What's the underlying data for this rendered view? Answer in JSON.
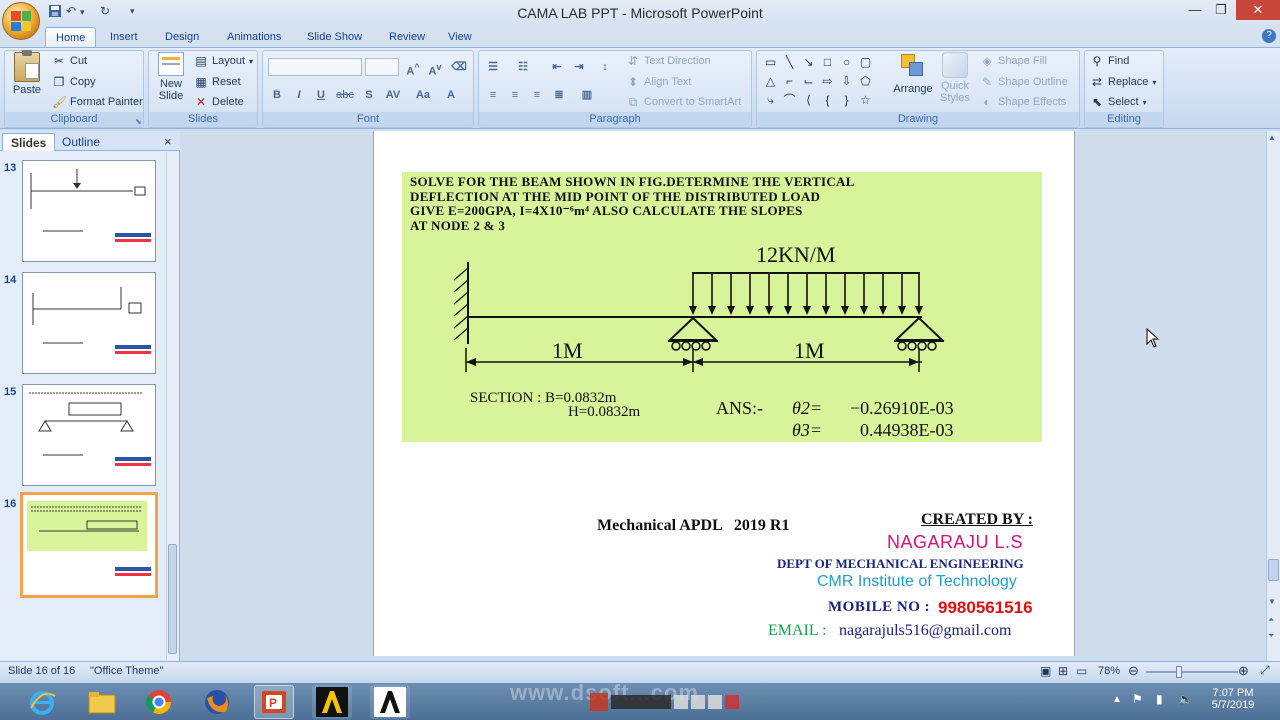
{
  "window": {
    "title": "CAMA LAB PPT - Microsoft PowerPoint",
    "minimize_glyph": "—",
    "restore_glyph": "❐",
    "close_glyph": "✕",
    "qat_icons": [
      "save-icon",
      "undo-icon",
      "redo-icon",
      "customize-qat-icon"
    ]
  },
  "tabs": [
    "Home",
    "Insert",
    "Design",
    "Animations",
    "Slide Show",
    "Review",
    "View"
  ],
  "active_tab": "Home",
  "ribbon": {
    "clipboard": {
      "label": "Clipboard",
      "paste": "Paste",
      "cut": "Cut",
      "copy": "Copy",
      "format_painter": "Format Painter"
    },
    "slides": {
      "label": "Slides",
      "new_slide": "New Slide",
      "layout": "Layout",
      "reset": "Reset",
      "delete": "Delete"
    },
    "font": {
      "label": "Font",
      "bold": "B",
      "italic": "I",
      "underline": "U",
      "strike": "abc",
      "shadow": "S",
      "spacing": "AV",
      "case": "Aa",
      "color": "A"
    },
    "paragraph": {
      "label": "Paragraph",
      "text_direction": "Text Direction",
      "align_text": "Align Text",
      "convert_smartart": "Convert to SmartArt"
    },
    "drawing": {
      "label": "Drawing",
      "arrange": "Arrange",
      "quick_styles": "Quick Styles",
      "shape_fill": "Shape Fill",
      "shape_outline": "Shape Outline",
      "shape_effects": "Shape Effects"
    },
    "editing": {
      "label": "Editing",
      "find": "Find",
      "replace": "Replace",
      "select": "Select"
    }
  },
  "pane": {
    "tabs": [
      "Slides",
      "Outline"
    ],
    "close": "×",
    "thumbnails": [
      {
        "number": "13"
      },
      {
        "number": "14"
      },
      {
        "number": "15"
      },
      {
        "number": "16",
        "selected": true
      }
    ]
  },
  "slide": {
    "problem": [
      "SOLVE FOR THE BEAM SHOWN IN FIG.DETERMINE THE VERTICAL",
      "DEFLECTION AT THE MID POINT OF THE DISTRIBUTED LOAD",
      "GIVE E=200GPA,  I=4X10⁻⁶m⁴   ALSO CALCULATE  THE SLOPES",
      "AT NODE 2 & 3"
    ],
    "load_label": "12KN/M",
    "span1": "1M",
    "span2": "1M",
    "section_line1": "SECTION : B=0.0832m",
    "section_line2": "H=0.0832m",
    "ans_prefix": "ANS:-",
    "theta2_label": "θ2=",
    "theta2_value": "−0.26910E-03",
    "theta3_label": "θ3=",
    "theta3_value": "0.44938E-03",
    "footer_left": "Mechanical APDL   2019 R1",
    "created_by": "CREATED BY :",
    "author": "NAGARAJU L.S",
    "dept": "DEPT OF MECHANICAL   ENGINEERING",
    "institute": "CMR Institute of Technology",
    "mobile_label": "MOBILE  NO :",
    "mobile_value": "9980561516",
    "email_label": "EMAIL :",
    "email_value": "nagarajuls516@gmail.com"
  },
  "status": {
    "slide_info": "Slide 16 of 16",
    "theme": "\"Office Theme\"",
    "zoom": "78%"
  },
  "taskbar": {
    "time": "7:07 PM",
    "date": "5/7/2019",
    "watermark": "www.dsoft...com",
    "apps": [
      "internet-explorer-icon",
      "file-explorer-icon",
      "chrome-icon",
      "firefox-icon",
      "powerpoint-icon",
      "ansys-icon",
      "ansys-apdl-icon"
    ]
  },
  "colors": {
    "slide_green": "#d8f49a",
    "author_magenta": "#d4147a",
    "institute_teal": "#1f9fc9",
    "mobile_red": "#e01010",
    "email_green": "#12a34a",
    "selected_thumb": "#f5a34b"
  }
}
